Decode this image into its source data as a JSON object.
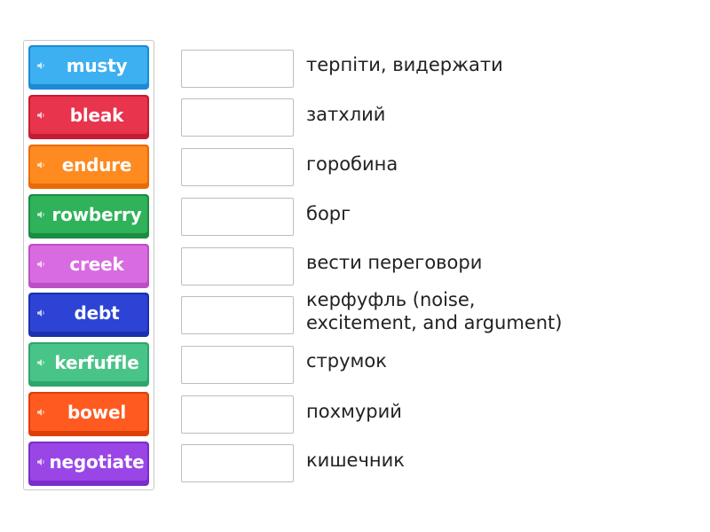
{
  "tiles": [
    {
      "word": "musty",
      "color_top": "#3cb0f0",
      "color_bottom": "#1e8ad6",
      "icon": "speaker-icon"
    },
    {
      "word": "bleak",
      "color_top": "#e8344c",
      "color_bottom": "#c41c33",
      "icon": "speaker-icon"
    },
    {
      "word": "endure",
      "color_top": "#ff8a1f",
      "color_bottom": "#ea6a08",
      "icon": "speaker-icon"
    },
    {
      "word": "rowberry",
      "color_top": "#2fb259",
      "color_bottom": "#1c8c42",
      "icon": "speaker-icon"
    },
    {
      "word": "creek",
      "color_top": "#d86be0",
      "color_bottom": "#bd4ec6",
      "icon": "speaker-icon"
    },
    {
      "word": "debt",
      "color_top": "#2c43d6",
      "color_bottom": "#1c2fb0",
      "icon": "speaker-icon"
    },
    {
      "word": "kerfuffle",
      "color_top": "#49c489",
      "color_bottom": "#2ea56d",
      "icon": "speaker-icon"
    },
    {
      "word": "bowel",
      "color_top": "#ff5a1f",
      "color_bottom": "#e03e08",
      "icon": "speaker-icon"
    },
    {
      "word": "negotiate",
      "color_top": "#9a46e6",
      "color_bottom": "#7a2ccc",
      "icon": "speaker-icon"
    }
  ],
  "definitions": [
    {
      "line1": "терпіти, видержати",
      "line2": ""
    },
    {
      "line1": "затхлий",
      "line2": ""
    },
    {
      "line1": "горобина",
      "line2": ""
    },
    {
      "line1": "борг",
      "line2": ""
    },
    {
      "line1": "вести переговори",
      "line2": ""
    },
    {
      "line1": "керфуфль (noise,",
      "line2": "excitement, and argument)"
    },
    {
      "line1": "струмок",
      "line2": ""
    },
    {
      "line1": "похмурий",
      "line2": ""
    },
    {
      "line1": "кишечник",
      "line2": ""
    }
  ]
}
